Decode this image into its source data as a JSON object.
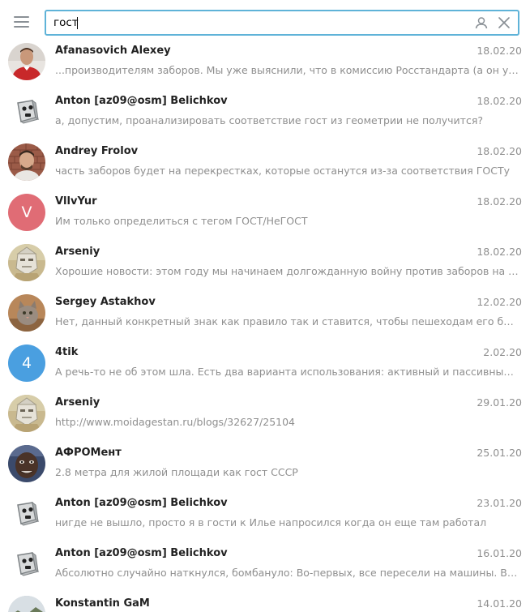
{
  "search": {
    "query": "гост"
  },
  "colors": {
    "accent": "#5fb3d8",
    "name_text": "#222222",
    "secondary_text": "#8f8f8f",
    "avatar_v": "#e06c75",
    "avatar_4": "#4a9fe0"
  },
  "results": [
    {
      "name": "Afanasovich Alexey",
      "date": "18.02.20",
      "preview": "...производителям заборов. Мы уже выяснили, что в комиссию Росстандарта (а он утвердит стандарт)",
      "avatar": "photo-red-shirt"
    },
    {
      "name": "Anton [az09@osm] Belichkov",
      "date": "18.02.20",
      "preview": "а, допустим, проанализировать соответствие гост из геометрии не получится?",
      "avatar": "robot-icon"
    },
    {
      "name": "Andrey Frolov",
      "date": "18.02.20",
      "preview": "часть заборов будет на перекрестках, которые останутся из-за соответствия ГОСТу",
      "avatar": "photo-man-brick-wall"
    },
    {
      "name": "VllvYur",
      "date": "18.02.20",
      "preview": "Им только определиться с тегом ГОСТ/НеГОСТ",
      "avatar": "letter",
      "avatar_letter": "V"
    },
    {
      "name": "Arseniy",
      "date": "18.02.20",
      "preview": "Хорошие новости: этом году мы начинаем долгожданную войну против заборов на чел...",
      "avatar": "photo-statue"
    },
    {
      "name": "Sergey Astakhov",
      "date": "12.02.20",
      "preview": "Нет, данный конкретный знак как правило так и ставится, чтобы пешеходам его было видно",
      "avatar": "photo-cat"
    },
    {
      "name": "4tik",
      "date": "2.02.20",
      "preview": "А речь-то не об этом шла.  Есть два варианта использования: активный и пассивный.  В ...",
      "avatar": "letter",
      "avatar_letter": "4"
    },
    {
      "name": "Arseniy",
      "date": "29.01.20",
      "preview": "http://www.moidagestan.ru/blogs/32627/25104",
      "avatar": "photo-statue"
    },
    {
      "name": "АФРОМент",
      "date": "25.01.20",
      "preview": "2.8 метра для жилой площади как гост СССР",
      "avatar": "photo-face-dark"
    },
    {
      "name": "Anton [az09@osm] Belichkov",
      "date": "23.01.20",
      "preview": "нигде не вышло, просто я в гости к Илье напросился когда он еще там работал",
      "avatar": "robot-icon"
    },
    {
      "name": "Anton [az09@osm] Belichkov",
      "date": "16.01.20",
      "preview": "Абсолютно случайно наткнулся, бомбануло:  Во-первых, все пересели на машины. Вот с...",
      "avatar": "robot-icon"
    },
    {
      "name": "Konstantin GaM",
      "date": "14.01.20",
      "preview": "",
      "avatar": "photo-landscape"
    }
  ]
}
